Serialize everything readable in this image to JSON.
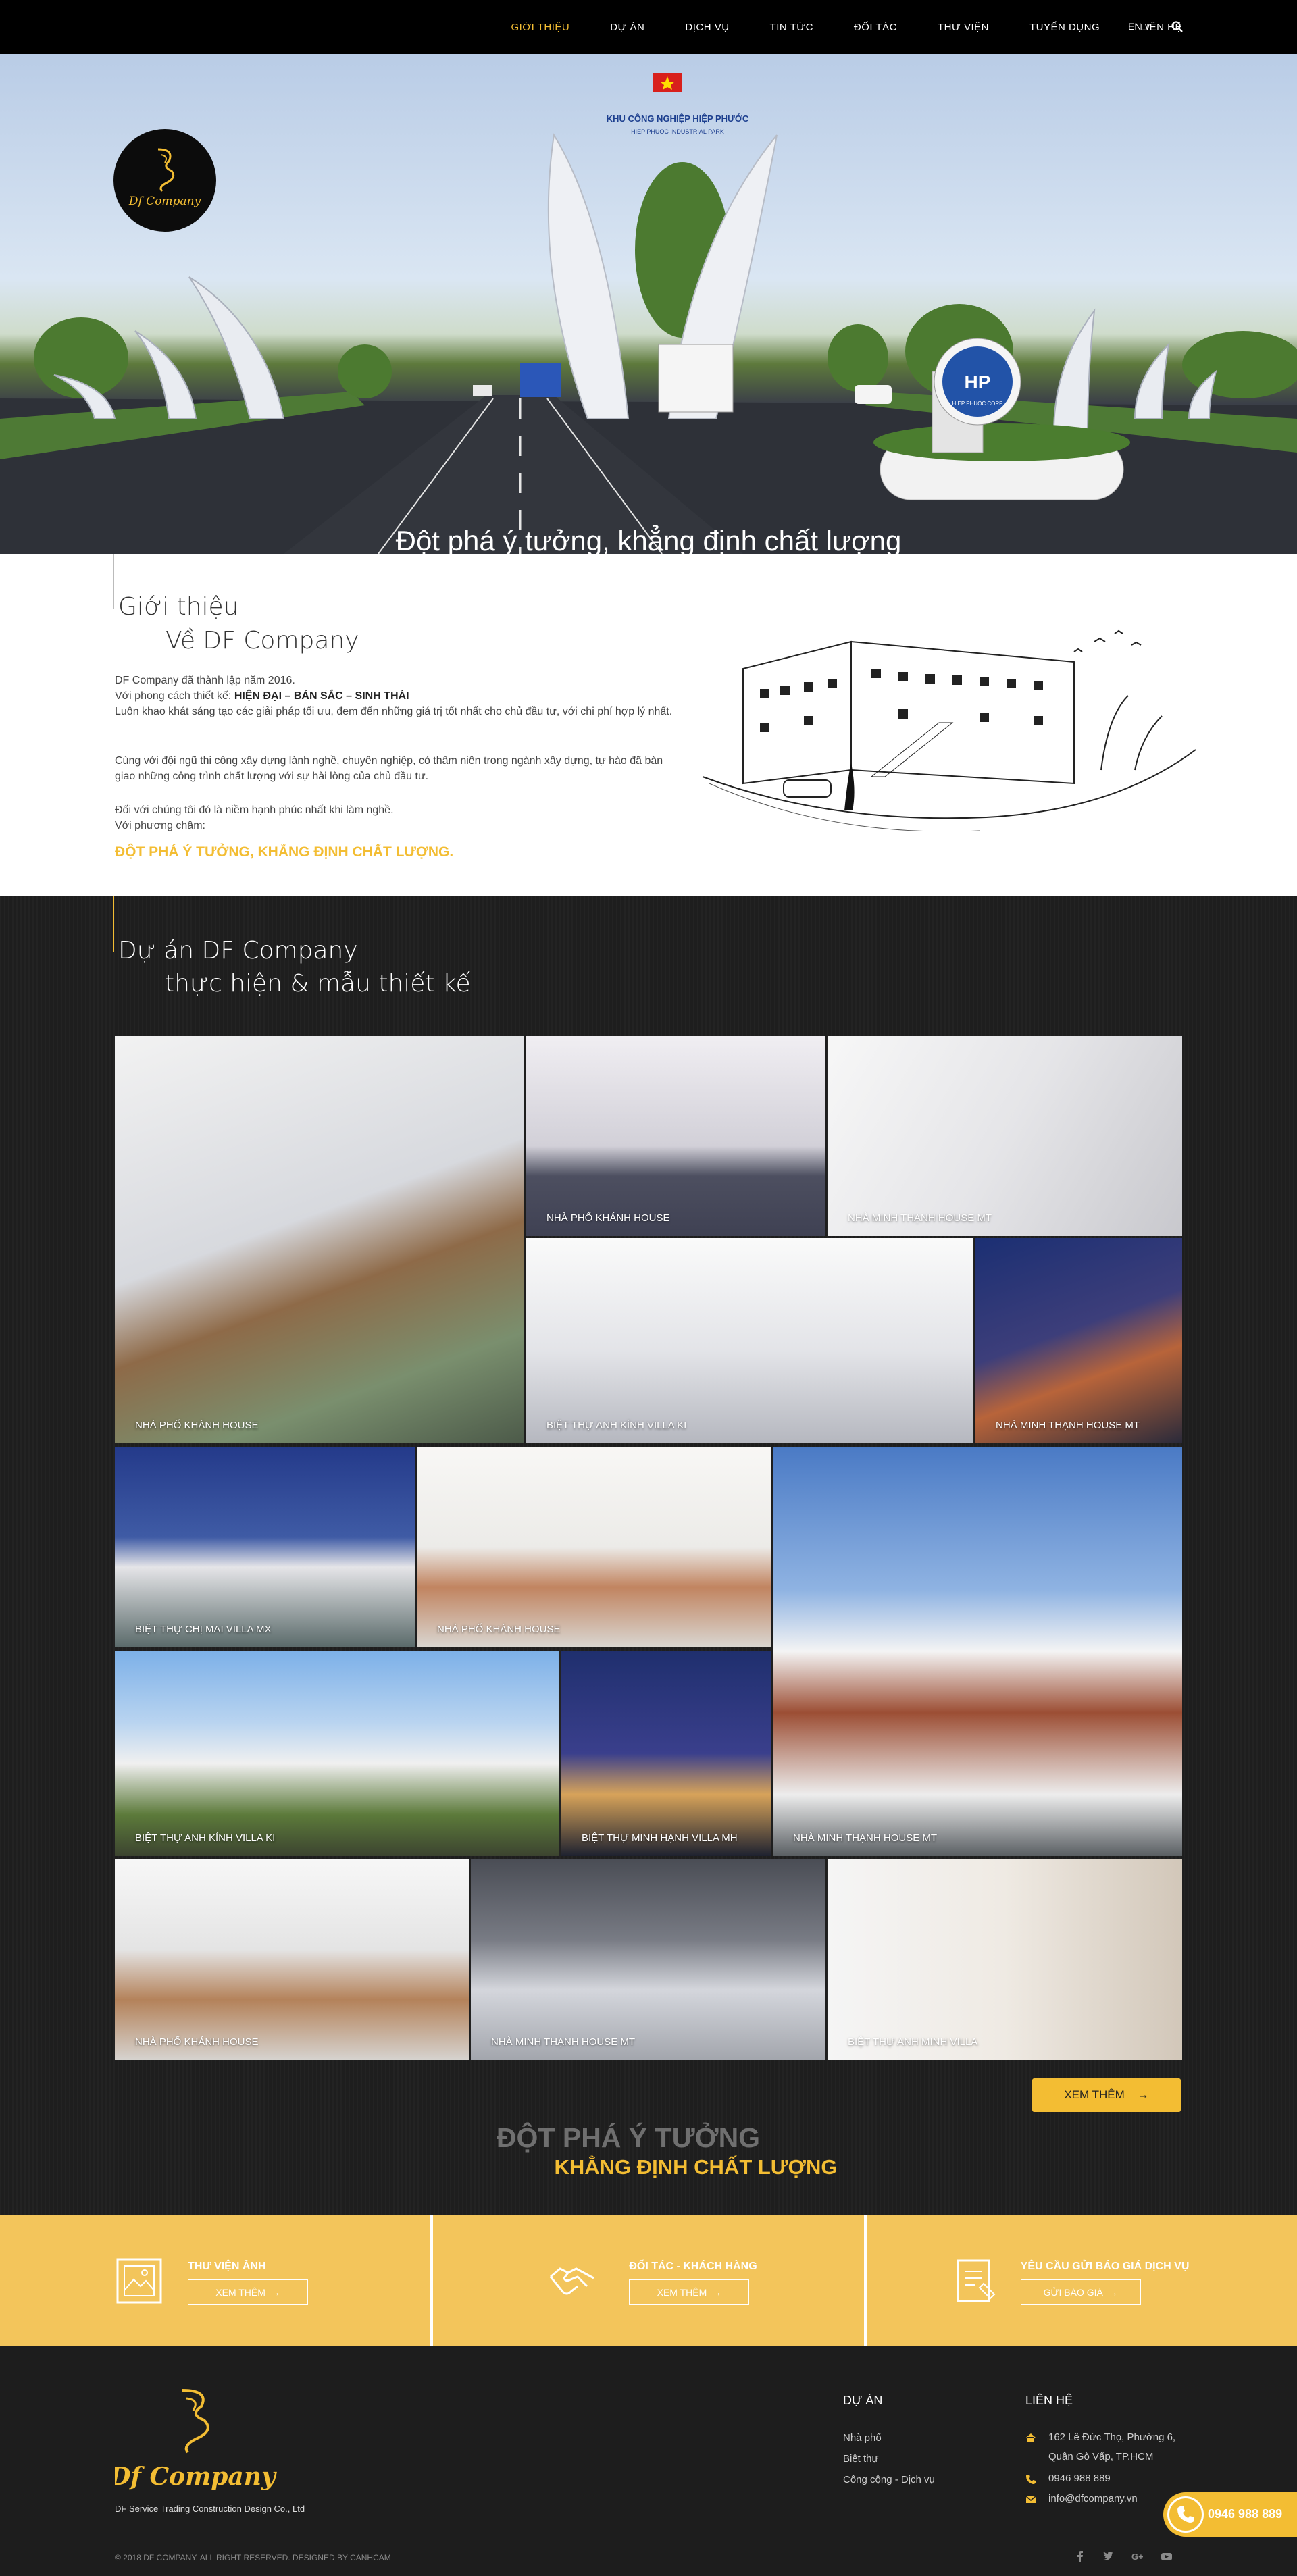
{
  "nav": {
    "items": [
      {
        "label": "GIỚI THIỆU",
        "active": true
      },
      {
        "label": "DỰ ÁN"
      },
      {
        "label": "DỊCH VỤ"
      },
      {
        "label": "TIN TỨC"
      },
      {
        "label": "ĐỐI TÁC"
      },
      {
        "label": "THƯ VIỆN"
      },
      {
        "label": "TUYỂN DỤNG"
      },
      {
        "label": "LIÊN HỆ"
      }
    ],
    "lang": "EN ∨",
    "search_icon": "search-icon"
  },
  "hero": {
    "caption": "Đột phá ý tưởng, khẳng định chất lượng",
    "signs": [
      "KHU CÔNG NGHIỆP HIỆP PHƯỚC",
      "HIEP PHUOC INDUSTRIAL PARK",
      "HP",
      "HIEP PHUOC CORP"
    ],
    "dots_count": 3,
    "active_dot": 0
  },
  "intro": {
    "title1": "Giới thiệu",
    "title2": "Về DF Company",
    "p1": "DF Company đã thành lập năm 2016.",
    "p2_prefix": "Với phong cách thiết kế:  ",
    "p2_bold": "HIỆN ĐẠI – BẢN SẮC – SINH THÁI",
    "p3": "Luôn khao khát sáng tạo các giải pháp tối ưu, đem đến những giá trị tốt nhất cho chủ đầu tư, với chi phí hợp lý nhất.",
    "p4": "Cùng với đội ngũ thi công xây dựng lành nghề, chuyên nghiệp, có thâm niên trong ngành xây dựng, tự hào đã bàn giao những công trình chất lượng với sự hài lòng của chủ đầu tư.",
    "p5": "Đối với chúng tôi đó là niềm hạnh phúc nhất khi làm nghề.",
    "p6": "Với phương châm:",
    "slogan": "ĐỘT PHÁ Ý TƯỞNG, KHẲNG ĐỊNH CHẤT LƯỢNG."
  },
  "projects": {
    "title1": "Dự án DF Company",
    "title2": "thực hiện & mẫu thiết kế",
    "tiles": [
      "NHÀ PHỐ KHÁNH HOUSE",
      "NHÀ PHỐ KHÁNH HOUSE",
      "NHÀ MINH THẠNH HOUSE MT",
      "BIỆT THỰ ANH KÍNH VILLA KI",
      "NHÀ MINH THẠNH HOUSE MT",
      "BIỆT THỰ CHỊ MAI VILLA MX",
      "NHÀ PHỐ KHÁNH HOUSE",
      "NHÀ MINH THẠNH HOUSE MT",
      "BIỆT THỰ ANH KÍNH VILLA KI",
      "BIỆT THỰ MINH HẠNH VILLA MH",
      "NHÀ PHỐ KHÁNH HOUSE",
      "NHÀ MINH THẠNH HOUSE MT",
      "BIỆT THỰ ANH MINH VILLA"
    ],
    "more_label": "XEM THÊM",
    "slogan1": "ĐỘT PHÁ Ý TƯỞNG",
    "slogan2": "KHẲNG ĐỊNH CHẤT LƯỢNG"
  },
  "cta": [
    {
      "label": "THƯ VIỆN ẢNH",
      "button": "XEM THÊM",
      "icon": "image-icon"
    },
    {
      "label": "ĐỐI TÁC - KHÁCH HÀNG",
      "button": "XEM THÊM",
      "icon": "handshake-icon"
    },
    {
      "label": "YÊU CẦU GỬI BÁO GIÁ DỊCH VỤ",
      "button": "GỬI BÁO GIÁ",
      "icon": "quote-document-icon"
    }
  ],
  "footer": {
    "brand": "Df Company",
    "tagline": "DF Service Trading Construction Design  Co., Ltd",
    "projects_title": "DỰ ÁN",
    "project_links": [
      "Nhà phố",
      "Biệt thự",
      "Công cộng - Dịch vụ"
    ],
    "contact_title": "LIÊN HỆ",
    "address1": "162 Lê Đức Thọ, Phường 6,",
    "address2": "Quận Gò Vấp, TP.HCM",
    "phone": "0946 988 889",
    "email": "info@dfcompany.vn",
    "copyright": "© 2018 DF Company. ALL RIGHT RESERVED. DESIGNED BY CANHCAM",
    "social": [
      "facebook-icon",
      "twitter-icon",
      "google-plus-icon",
      "youtube-icon"
    ]
  },
  "floating_phone": "0946 988 889",
  "colors": {
    "accent": "#f3bd33",
    "dark": "#1d1d1d",
    "nav": "#000000"
  }
}
